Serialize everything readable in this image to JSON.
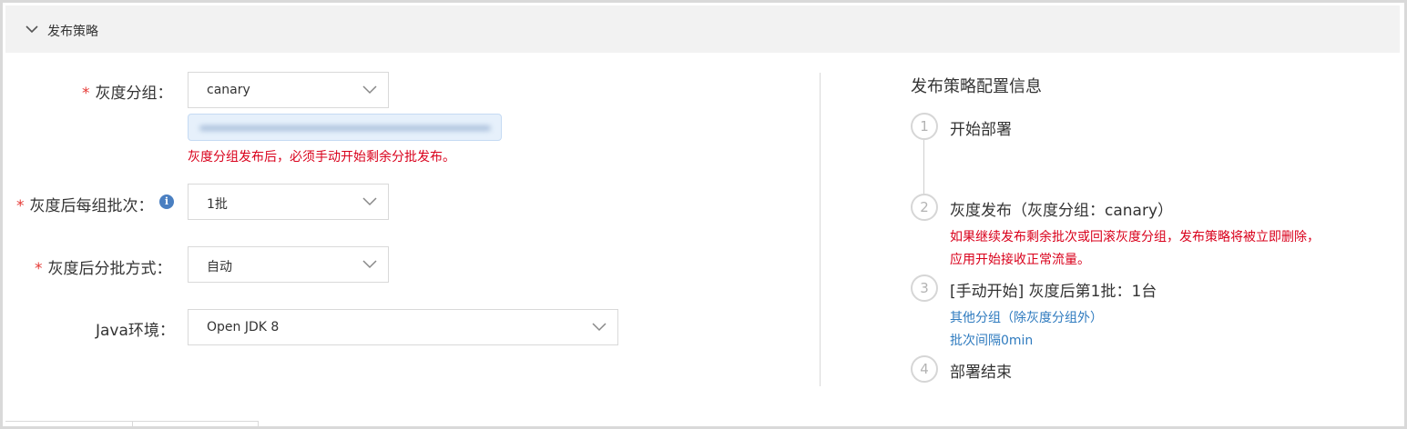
{
  "section": {
    "title": "发布策略"
  },
  "form": {
    "canary_group": {
      "label": "灰度分组：",
      "required_mark": "*",
      "value": "canary",
      "error": "灰度分组发布后，必须手动开始剩余分批发布。"
    },
    "batches_per_group": {
      "label": "灰度后每组批次：",
      "required_mark": "*",
      "info_icon": "i",
      "value": "1批"
    },
    "batch_mode": {
      "label": "灰度后分批方式：",
      "required_mark": "*",
      "value": "自动"
    },
    "java_env": {
      "label": "Java环境：",
      "value": "Open JDK 8"
    }
  },
  "sidebar": {
    "title": "发布策略配置信息",
    "steps": [
      {
        "num": "1",
        "title": "开始部署"
      },
      {
        "num": "2",
        "title": "灰度发布（灰度分组：canary）",
        "notes_red": [
          "如果继续发布剩余批次或回滚灰度分组，发布策略将被立即删除，",
          "应用开始接收正常流量。"
        ]
      },
      {
        "num": "3",
        "title": "[手动开始] 灰度后第1批：1台",
        "notes_blue": [
          "其他分组（除灰度分组外）",
          "批次间隔0min"
        ]
      },
      {
        "num": "4",
        "title": "部署结束"
      }
    ]
  },
  "colors": {
    "required": "#e53935",
    "error": "#d9001b",
    "link": "#2f7bbf",
    "info": "#4a7fc1"
  }
}
